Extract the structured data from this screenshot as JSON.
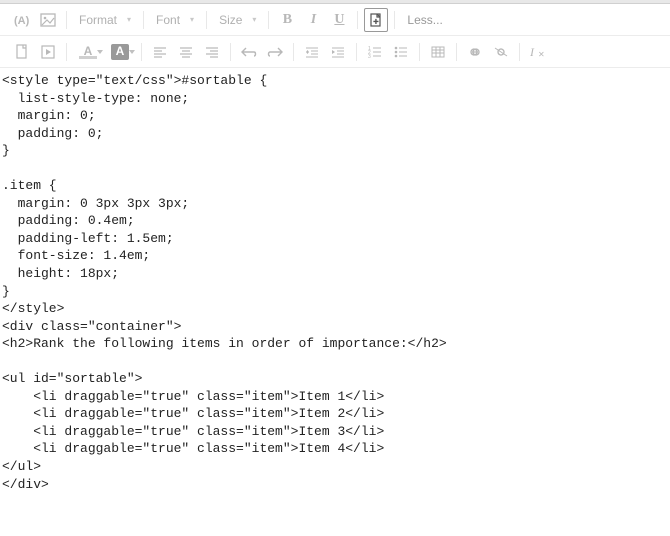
{
  "toolbar1": {
    "format_label": "Format",
    "font_label": "Font",
    "size_label": "Size",
    "bold_glyph": "B",
    "italic_glyph": "I",
    "underline_glyph": "U",
    "less_label": "Less..."
  },
  "toolbar2": {
    "font_color_glyph": "A",
    "bg_color_glyph": "A"
  },
  "code_lines": [
    "<style type=\"text/css\">#sortable {",
    "  list-style-type: none;",
    "  margin: 0;",
    "  padding: 0;",
    "}",
    "",
    ".item {",
    "  margin: 0 3px 3px 3px;",
    "  padding: 0.4em;",
    "  padding-left: 1.5em;",
    "  font-size: 1.4em;",
    "  height: 18px;",
    "}",
    "</style>",
    "<div class=\"container\">",
    "<h2>Rank the following items in order of importance:</h2>",
    "",
    "<ul id=\"sortable\">",
    "    <li draggable=\"true\" class=\"item\">Item 1</li>",
    "    <li draggable=\"true\" class=\"item\">Item 2</li>",
    "    <li draggable=\"true\" class=\"item\">Item 3</li>",
    "    <li draggable=\"true\" class=\"item\">Item 4</li>",
    "</ul>",
    "</div>"
  ]
}
